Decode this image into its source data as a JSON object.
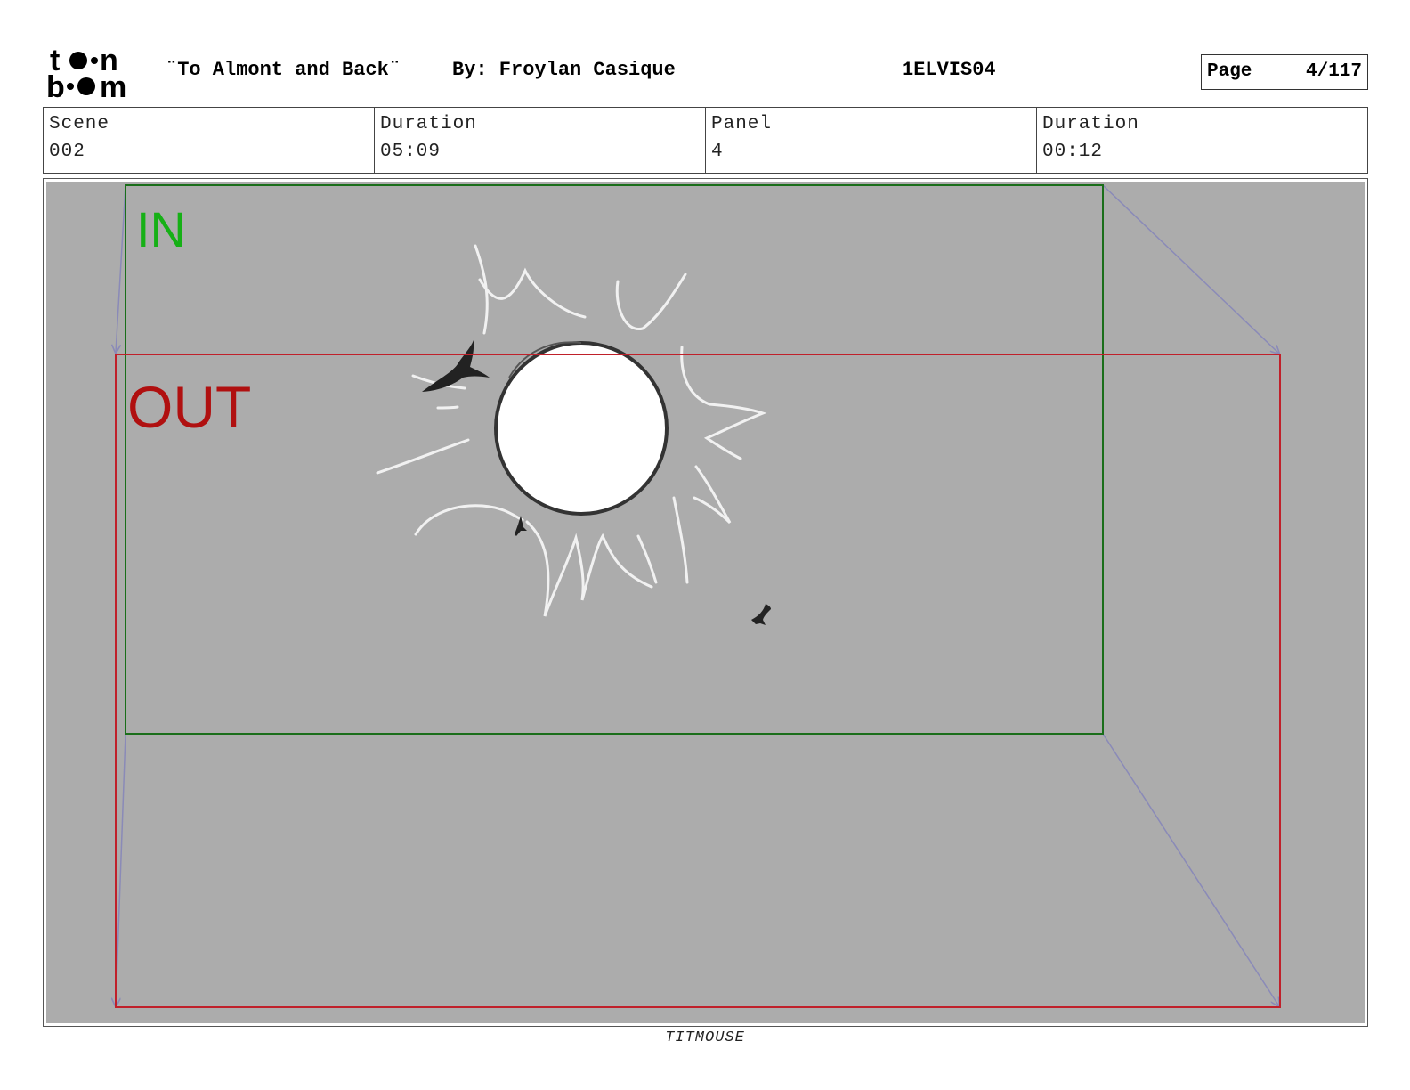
{
  "header": {
    "logo_text_top": "toon",
    "logo_text_bottom": "boom",
    "title": "¨To Almont and Back¨",
    "author": "By: Froylan Casique",
    "episode_code": "1ELVIS04",
    "page_label": "Page",
    "page_number": "4/117"
  },
  "info": {
    "scene_label": "Scene",
    "scene_value": "002",
    "scene_duration_label": "Duration",
    "scene_duration_value": "05:09",
    "panel_label": "Panel",
    "panel_value": "4",
    "panel_duration_label": "Duration",
    "panel_duration_value": "00:12"
  },
  "panel": {
    "in_label": "IN",
    "out_label": "OUT",
    "colors": {
      "background": "#acacac",
      "in_frame": "#1a6e1a",
      "in_text": "#16b016",
      "out_frame": "#c0202a",
      "out_text": "#b01010",
      "arrows": "#8a8ab8"
    }
  },
  "footer": {
    "studio": "TITMOUSE"
  }
}
